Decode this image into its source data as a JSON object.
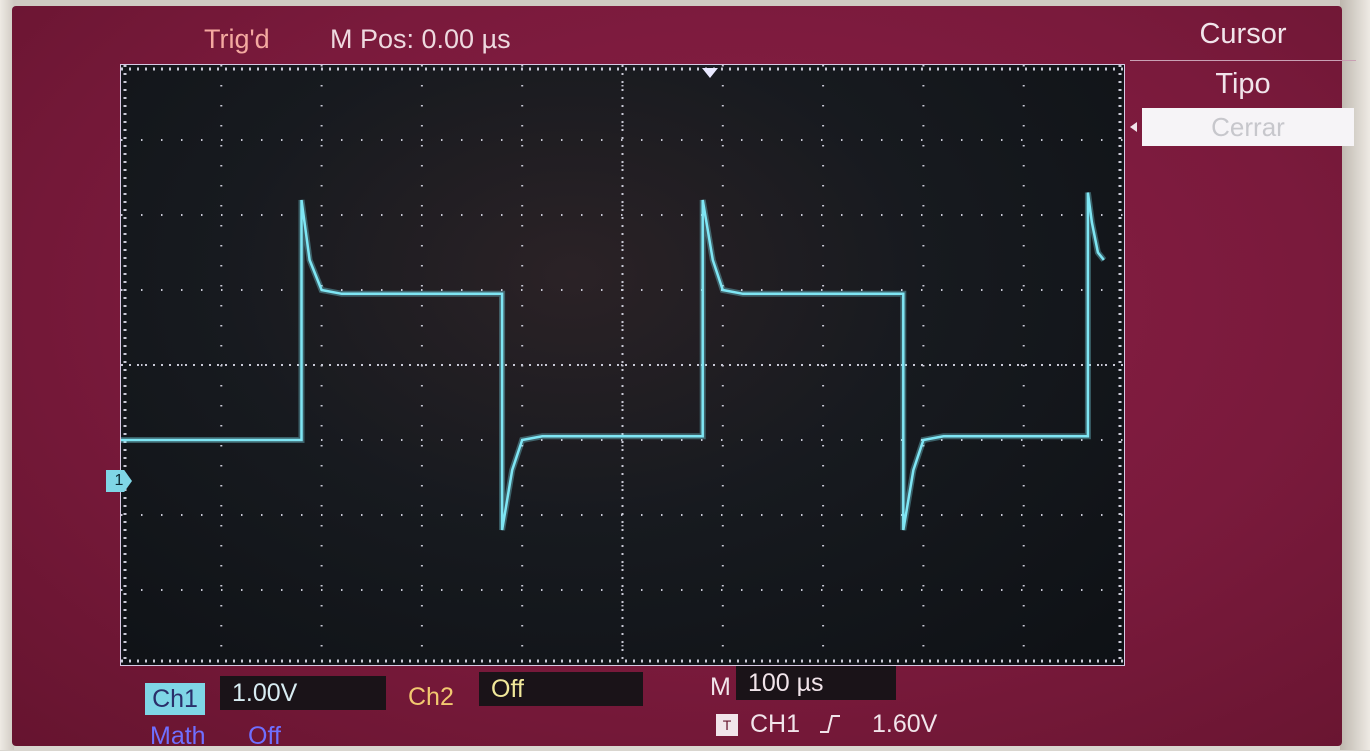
{
  "header": {
    "trigger_status": "Trig'd",
    "horizontal_position": "M Pos: 0.00 µs"
  },
  "menu": {
    "title": "Cursor",
    "subtitle": "Tipo",
    "selected_option": "Cerrar"
  },
  "channels": {
    "ch1": {
      "label": "Ch1",
      "scale": "1.00V",
      "marker": "1"
    },
    "ch2": {
      "label": "Ch2",
      "state": "Off"
    },
    "math": {
      "label": "Math",
      "state": "Off"
    }
  },
  "timebase": {
    "label": "M",
    "value": "100 µs"
  },
  "trigger": {
    "icon_label": "T",
    "source": "CH1",
    "slope_icon": "rising-edge-icon",
    "level": "1.60V"
  },
  "colors": {
    "screen_background": "#7a1a3c",
    "trace": "#7fe6f4",
    "ch1": "#7fd6e6",
    "ch2": "#f2c870",
    "math": "#6f6fff"
  },
  "chart_data": {
    "type": "line",
    "series": [
      {
        "x": [
          0,
          90,
          90,
          94,
          100,
          110,
          190,
          190,
          195,
          200,
          210,
          290,
          290,
          295,
          300,
          310,
          390,
          390,
          395,
          400,
          410,
          482,
          482,
          484,
          487,
          490
        ],
        "y": [
          -1.0,
          -1.0,
          2.2,
          1.4,
          1.0,
          0.95,
          0.95,
          -2.2,
          -1.4,
          -1.0,
          -0.95,
          -0.95,
          2.2,
          1.4,
          1.0,
          0.95,
          0.95,
          -2.2,
          -1.4,
          -1.0,
          -0.95,
          -0.95,
          2.3,
          1.9,
          1.5,
          1.4
        ]
      }
    ],
    "xlim": [
      0,
      500
    ],
    "ylim": [
      -4,
      4
    ],
    "grid": true
  }
}
